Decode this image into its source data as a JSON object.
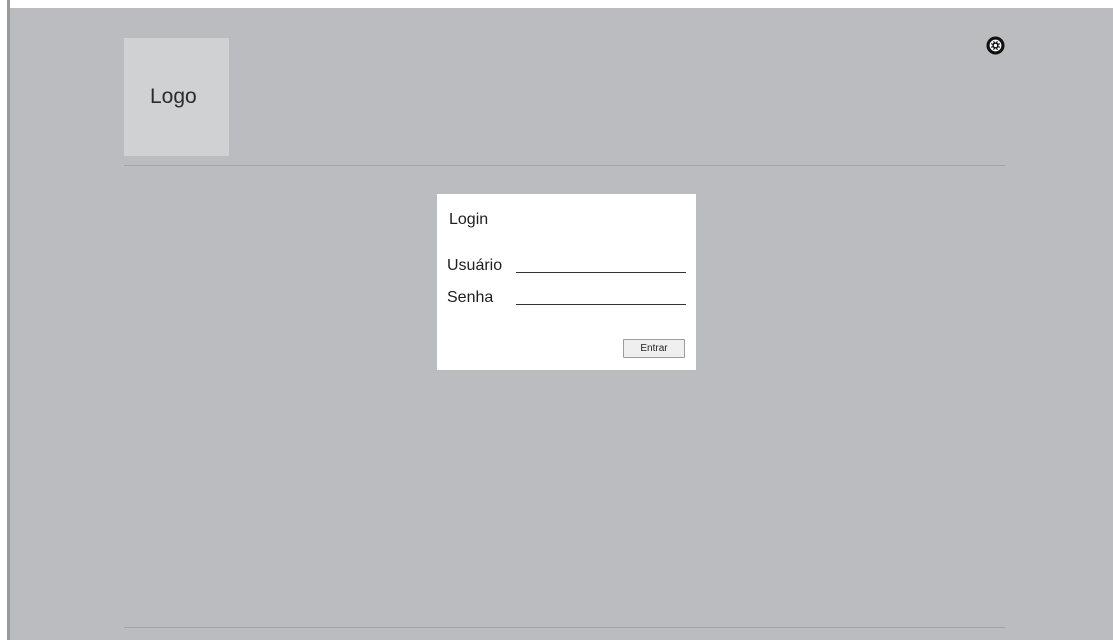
{
  "header": {
    "logo_text": "Logo",
    "settings_icon": "settings-icon"
  },
  "login": {
    "title": "Login",
    "username_label": "Usuário",
    "username_value": "",
    "password_label": "Senha",
    "password_value": "",
    "submit_label": "Entrar"
  },
  "colors": {
    "canvas_background": "#bbbcbf",
    "logo_background": "#d0d1d3",
    "panel_background": "#ffffff"
  }
}
